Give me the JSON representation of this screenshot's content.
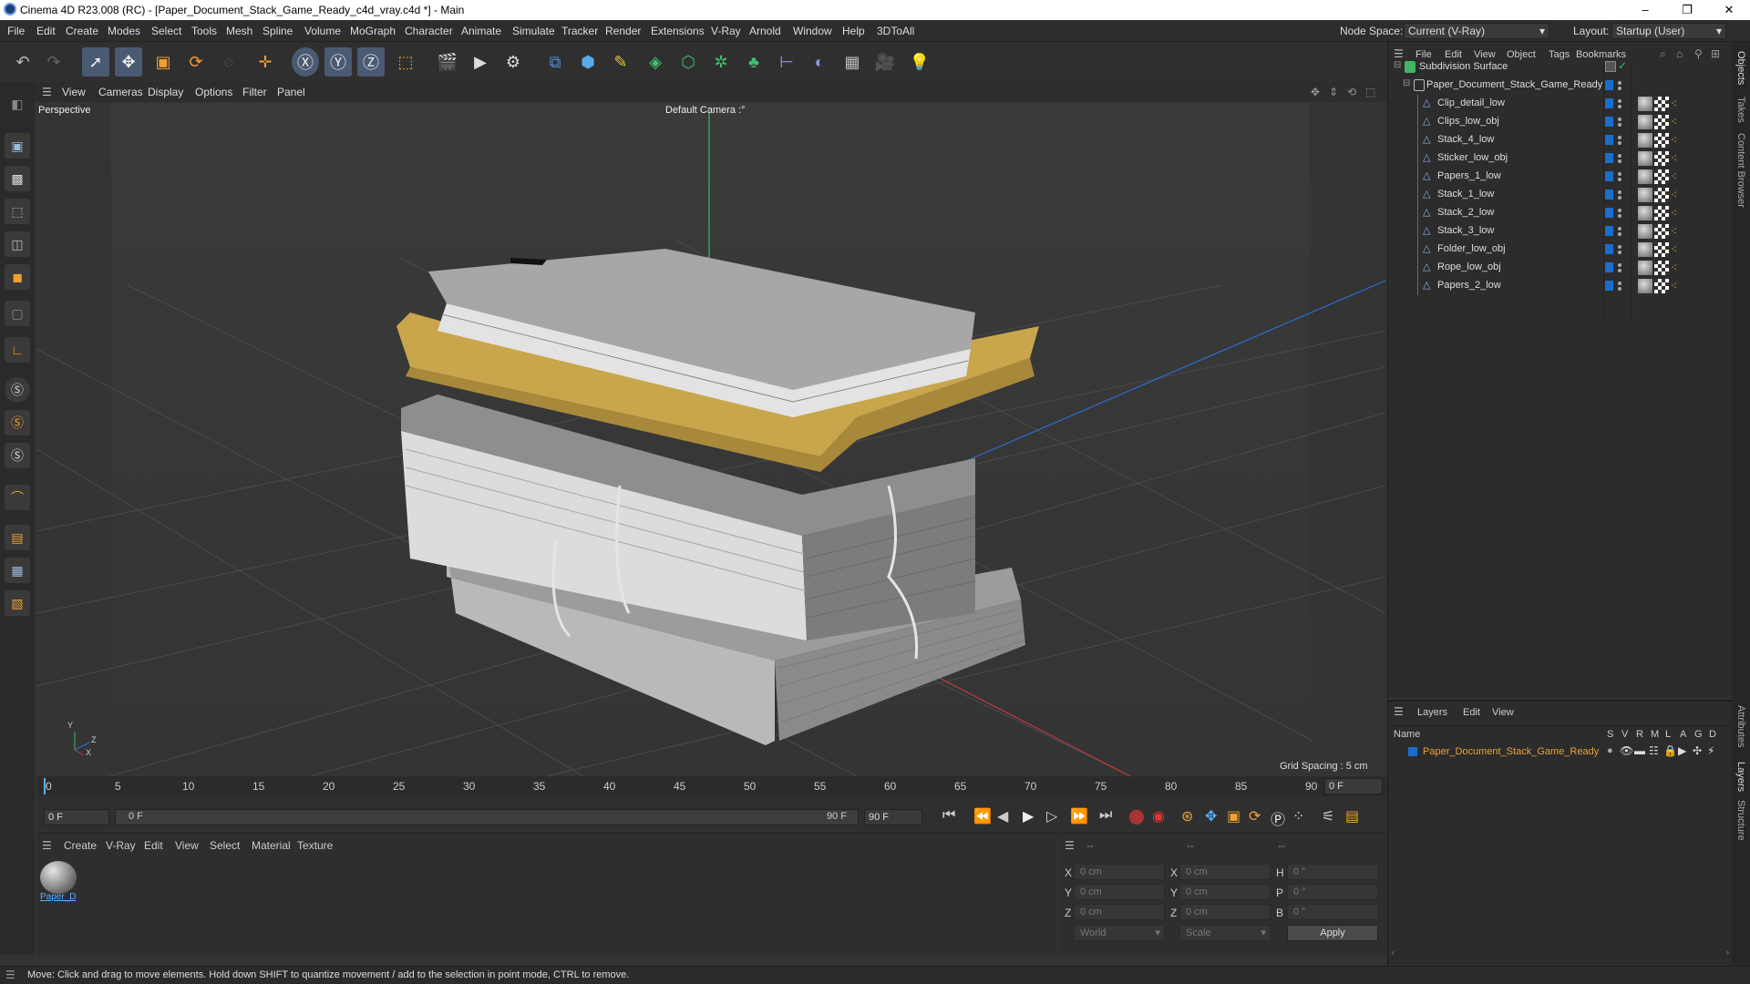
{
  "window": {
    "title": "Cinema 4D R23.008 (RC) - [Paper_Document_Stack_Game_Ready_c4d_vray.c4d *] - Main",
    "controls": [
      "–",
      "❐",
      "✕"
    ]
  },
  "menubar": {
    "items": [
      "File",
      "Edit",
      "Create",
      "Modes",
      "Select",
      "Tools",
      "Mesh",
      "Spline",
      "Volume",
      "MoGraph",
      "Character",
      "Animate",
      "Simulate",
      "Tracker",
      "Render",
      "Extensions",
      "V-Ray",
      "Arnold",
      "Window",
      "Help",
      "3DToAll"
    ],
    "node_space_label": "Node Space:",
    "node_space_value": "Current (V-Ray)",
    "layout_label": "Layout:",
    "layout_value": "Startup (User)"
  },
  "viewport": {
    "menu": [
      "View",
      "Cameras",
      "Display",
      "Options",
      "Filter",
      "Panel"
    ],
    "view_name": "Perspective",
    "camera": "Default Camera",
    "grid_spacing": "Grid Spacing : 5 cm",
    "axis_y": "Y",
    "axis_z": "Z",
    "axis_x": "X"
  },
  "timeline": {
    "ticks": [
      "0",
      "5",
      "10",
      "15",
      "20",
      "25",
      "30",
      "35",
      "40",
      "45",
      "50",
      "55",
      "60",
      "65",
      "70",
      "75",
      "80",
      "85",
      "90"
    ],
    "current_frame": "0 F",
    "start_field": "0 F",
    "range_start": "0 F",
    "range_end": "90 F",
    "end_field": "90 F"
  },
  "material_panel": {
    "menu": [
      "Create",
      "V-Ray",
      "Edit",
      "View",
      "Select",
      "Material",
      "Texture"
    ],
    "material_name": "Paper_D"
  },
  "coords": {
    "header_a": "--",
    "header_b": "--",
    "header_c": "--",
    "rows": [
      {
        "l1": "X",
        "v1": "0 cm",
        "l2": "X",
        "v2": "0 cm",
        "l3": "H",
        "v3": "0 °"
      },
      {
        "l1": "Y",
        "v1": "0 cm",
        "l2": "Y",
        "v2": "0 cm",
        "l3": "P",
        "v3": "0 °"
      },
      {
        "l1": "Z",
        "v1": "0 cm",
        "l2": "Z",
        "v2": "0 cm",
        "l3": "B",
        "v3": "0 °"
      }
    ],
    "space": "World",
    "mode": "Scale",
    "apply": "Apply"
  },
  "objects_panel": {
    "menu": [
      "File",
      "Edit",
      "View",
      "Object",
      "Tags",
      "Bookmarks"
    ],
    "root": "Subdivision Surface",
    "group": "Paper_Document_Stack_Game_Ready",
    "children": [
      "Clip_detail_low",
      "Clips_low_obj",
      "Stack_4_low",
      "Sticker_low_obj",
      "Papers_1_low",
      "Stack_1_low",
      "Stack_2_low",
      "Stack_3_low",
      "Folder_low_obj",
      "Rope_low_obj",
      "Papers_2_low"
    ]
  },
  "layers_panel": {
    "menu": [
      "Layers",
      "Edit",
      "View"
    ],
    "columns": [
      "Name",
      "S",
      "V",
      "R",
      "M",
      "L",
      "A",
      "G",
      "D"
    ],
    "layer_name": "Paper_Document_Stack_Game_Ready",
    "layer_color": "#1a6ecb"
  },
  "side_tabs": [
    "Objects",
    "Takes",
    "Content Browser",
    "Attributes",
    "Layers",
    "Structure"
  ],
  "status": "Move: Click and drag to move elements. Hold down SHIFT to quantize movement / add to the selection in point mode, CTRL to remove.",
  "colors": {
    "accent": "#1a6ecb",
    "folder": "#c9a54c",
    "layer_text": "#e8a43a"
  }
}
